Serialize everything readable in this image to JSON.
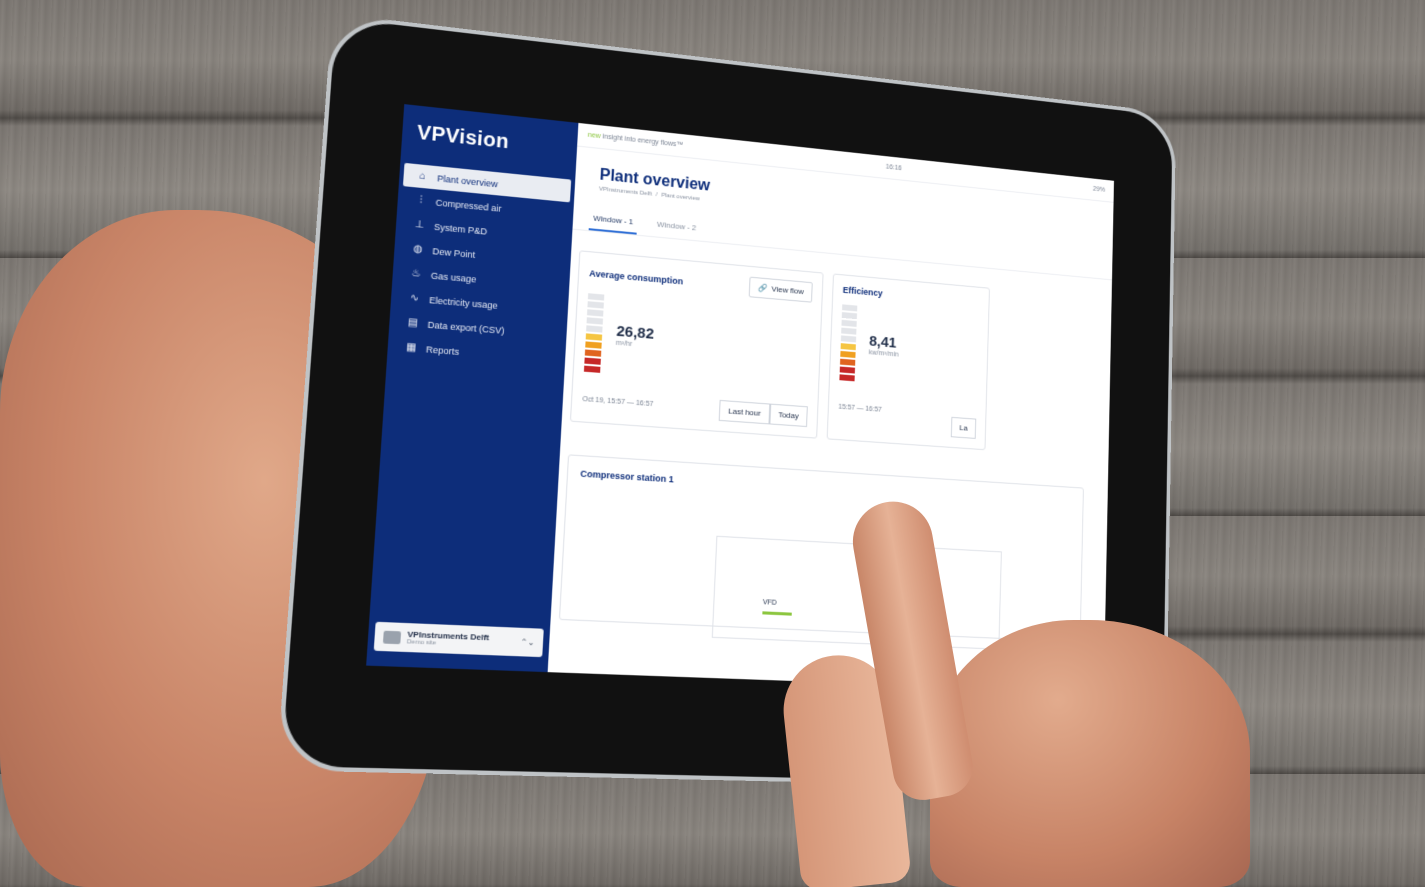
{
  "app": {
    "brand": "VPVision",
    "tagline_accent": "new",
    "tagline": "insight into energy flows™",
    "clock": "16:16",
    "battery": "29%"
  },
  "sidebar": {
    "items": [
      {
        "label": "Plant overview",
        "icon": "building-icon",
        "active": true
      },
      {
        "label": "Compressed air",
        "icon": "sliders-icon",
        "active": false
      },
      {
        "label": "System P&D",
        "icon": "network-icon",
        "active": false
      },
      {
        "label": "Dew Point",
        "icon": "droplet-icon",
        "active": false
      },
      {
        "label": "Gas usage",
        "icon": "gas-icon",
        "active": false
      },
      {
        "label": "Electricity usage",
        "icon": "wave-icon",
        "active": false
      },
      {
        "label": "Data export (CSV)",
        "icon": "file-icon",
        "active": false
      },
      {
        "label": "Reports",
        "icon": "report-icon",
        "active": false
      }
    ],
    "org": {
      "name": "VPInstruments Delft",
      "sub": "Demo site"
    }
  },
  "page": {
    "title": "Plant overview",
    "breadcrumb": [
      "VPInstruments Delft",
      "/",
      "Plant overview"
    ],
    "tabs": [
      {
        "label": "Window - 1",
        "active": true
      },
      {
        "label": "Window - 2",
        "active": false
      }
    ]
  },
  "cards": {
    "consumption": {
      "title": "Average consumption",
      "button": "View flow",
      "value": "26,82",
      "unit": "m³/hr",
      "range": "Oct 19, 15:57 — 16:57",
      "buttons": [
        "Last hour",
        "Today"
      ],
      "level_segments": 5,
      "total_segments": 10
    },
    "efficiency": {
      "title": "Efficiency",
      "value": "8,41",
      "unit": "kw/m³/min",
      "range": "15:57 — 16:57",
      "button": "La",
      "level_segments": 5,
      "total_segments": 10
    }
  },
  "station": {
    "title": "Compressor station 1",
    "vfd_label": "VFD"
  }
}
